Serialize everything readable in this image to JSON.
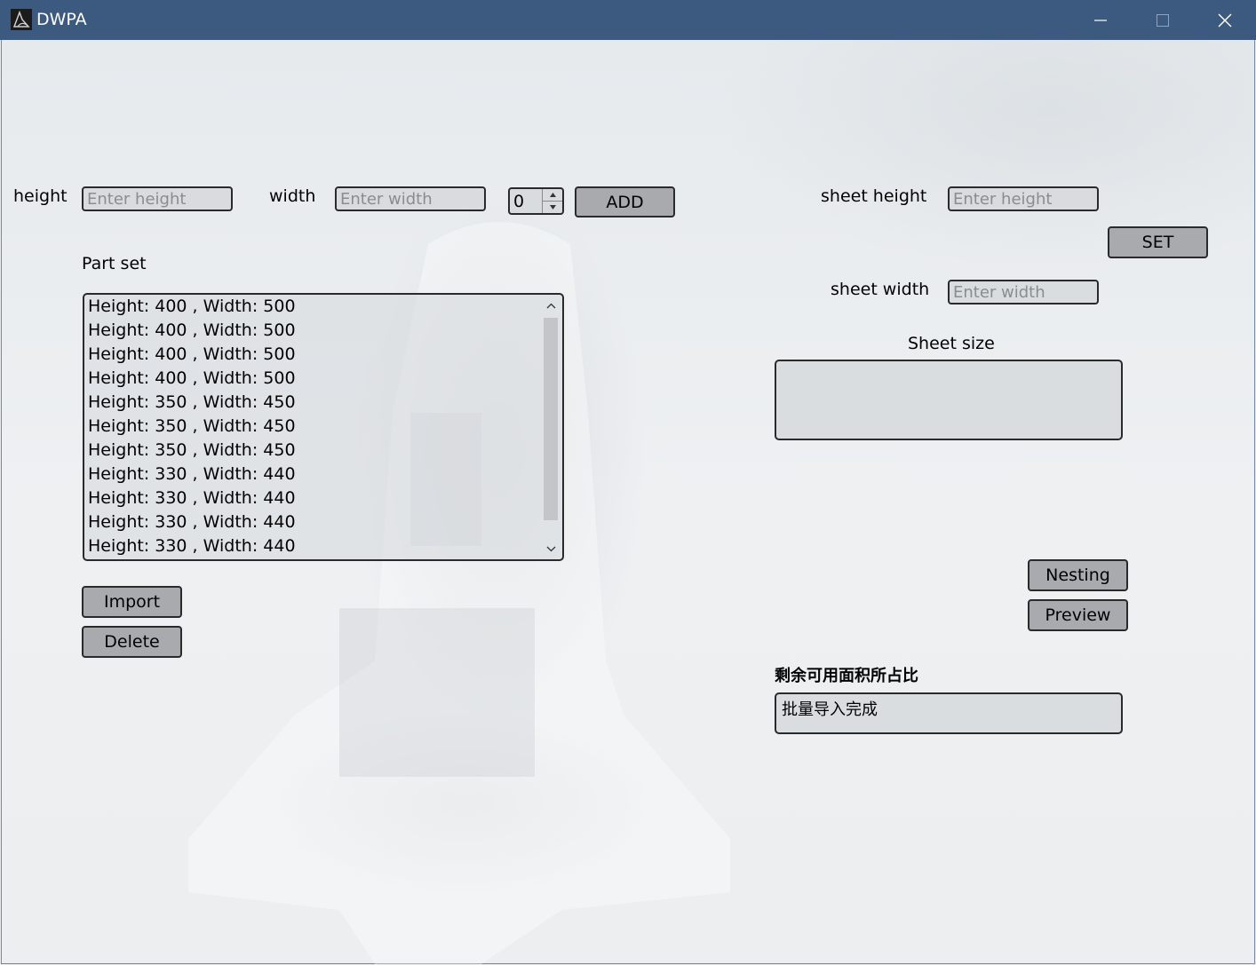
{
  "window": {
    "title": "DWPA",
    "icon": "app-logo-icon",
    "controls": [
      "minimize-icon",
      "maximize-icon",
      "close-icon"
    ]
  },
  "part_inputs": {
    "height_label": "height",
    "height_placeholder": "Enter height",
    "width_label": "width",
    "width_placeholder": "Enter width",
    "quantity_value": "0",
    "add_label": "ADD"
  },
  "part_set": {
    "title": "Part set",
    "items": [
      "Height: 400 , Width: 500",
      "Height: 400 , Width: 500",
      "Height: 400 , Width: 500",
      "Height: 400 , Width: 500",
      "Height: 350 , Width: 450",
      "Height: 350 , Width: 450",
      "Height: 350 , Width: 450",
      "Height: 330 , Width: 440",
      "Height: 330 , Width: 440",
      "Height: 330 , Width: 440",
      "Height: 330 , Width: 440"
    ],
    "import_label": "Import",
    "delete_label": "Delete"
  },
  "sheet": {
    "height_label": "sheet height",
    "height_placeholder": "Enter height",
    "set_label": "SET",
    "width_label": "sheet width",
    "width_placeholder": "Enter width",
    "size_title": "Sheet size",
    "size_value": ""
  },
  "actions": {
    "nesting_label": "Nesting",
    "preview_label": "Preview"
  },
  "ratio": {
    "title": "剩余可用面积所占比",
    "status": "批量导入完成"
  },
  "colors": {
    "titlebar": "#3c5a80",
    "button": "#a8aaad",
    "field": "#d6d9dc"
  }
}
